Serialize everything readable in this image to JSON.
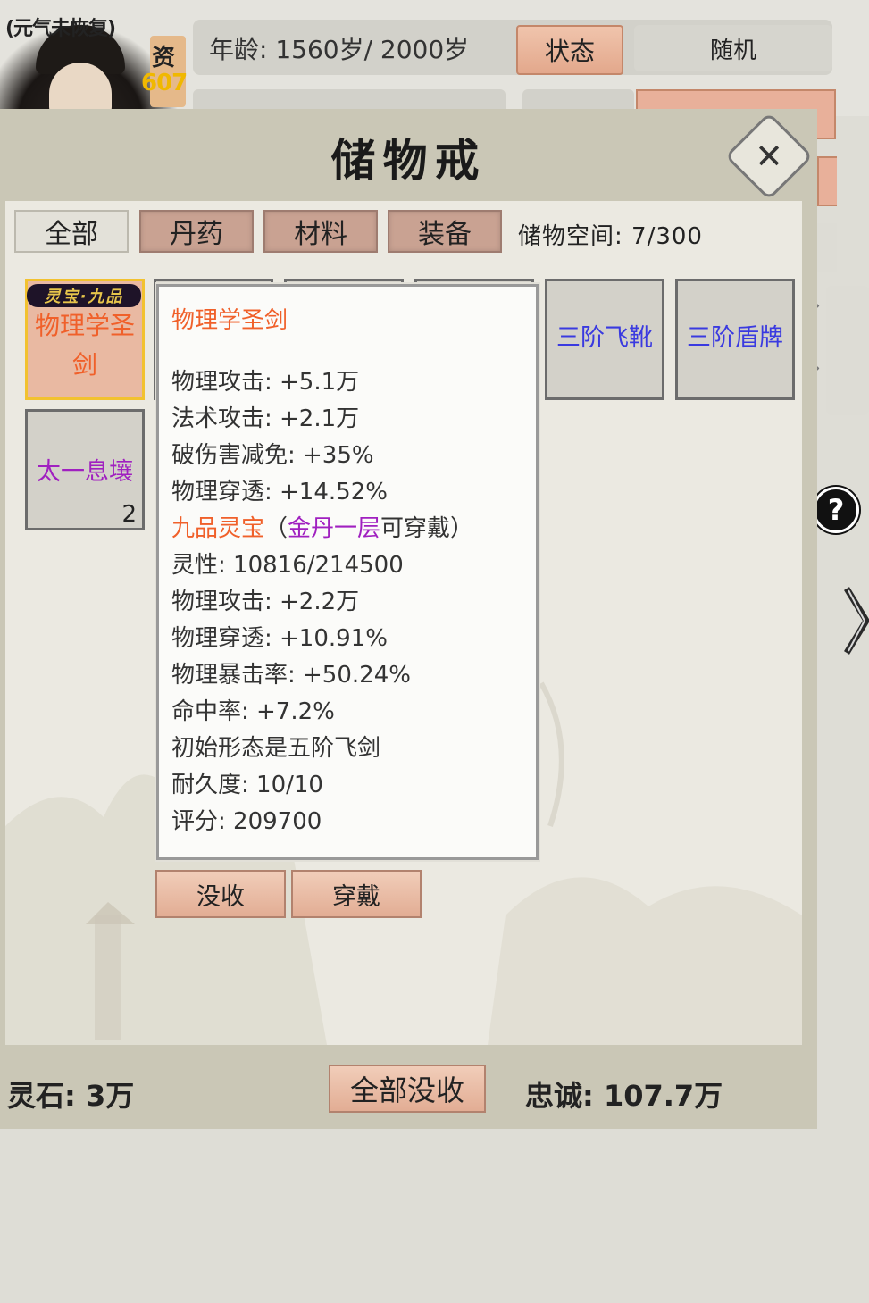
{
  "header": {
    "status_tip": "(元气未恢复)",
    "aptitude_label": "资",
    "aptitude_value": "607",
    "age": "年龄: 1560岁/ 2000岁",
    "status_button": "状态",
    "random_button": "随机"
  },
  "dialog": {
    "title": "储物戒",
    "tabs": [
      {
        "label": "全部",
        "active": true
      },
      {
        "label": "丹药",
        "active": false
      },
      {
        "label": "材料",
        "active": false
      },
      {
        "label": "装备",
        "active": false
      }
    ],
    "capacity": "储物空间: 7/300",
    "items": [
      {
        "name": "物理学圣剑",
        "tag": "灵宝·九品",
        "color": "#f0602a",
        "selected": true
      },
      {
        "name": "三阶飞靴",
        "color": "#3a3ae0"
      },
      {
        "name": "三阶盾牌",
        "color": "#3a3ae0"
      },
      {
        "name": "太一息壤",
        "color": "#a020c0",
        "count": "2"
      }
    ],
    "tooltip": {
      "title": "物理学圣剑",
      "stats": [
        "物理攻击: +5.1万",
        "法术攻击: +2.1万",
        "破伤害减免: +35%",
        "物理穿透: +14.52%"
      ],
      "grade_part1": "九品灵宝",
      "grade_part2": "（",
      "grade_part3": "金丹一层",
      "grade_part4": "可穿戴）",
      "details": [
        "灵性: 10816/214500",
        "物理攻击: +2.2万",
        "物理穿透: +10.91%",
        "物理暴击率: +50.24%",
        "命中率: +7.2%",
        "初始形态是五阶飞剑",
        "耐久度: 10/10",
        "评分: 209700"
      ]
    },
    "actions": {
      "confiscate": "没收",
      "equip": "穿戴"
    },
    "footer": {
      "spirit_stones": "灵石: 3万",
      "confiscate_all": "全部没收",
      "loyalty": "忠诚: 107.7万"
    }
  },
  "colors": {
    "orange": "#f0602a",
    "purple": "#a020c0",
    "blue": "#3a3ae0",
    "gold": "#f0b800"
  }
}
